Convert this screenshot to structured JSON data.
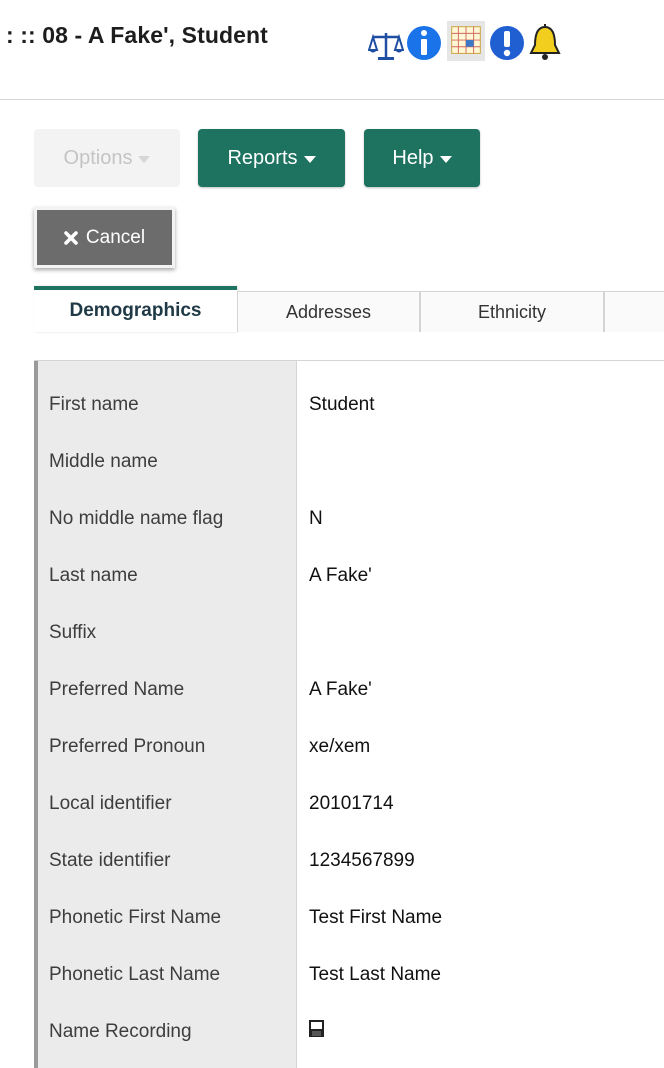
{
  "header": {
    "title": ": :: 08 - A Fake', Student"
  },
  "icons": [
    "scale-icon",
    "info-icon",
    "calendar-icon",
    "alert-icon",
    "bell-icon"
  ],
  "toolbar": {
    "options_label": "Options",
    "reports_label": "Reports",
    "help_label": "Help",
    "cancel_label": "Cancel"
  },
  "tabs": [
    {
      "label": "Demographics",
      "active": true
    },
    {
      "label": "Addresses",
      "active": false
    },
    {
      "label": "Ethnicity",
      "active": false
    },
    {
      "label": "",
      "active": false
    }
  ],
  "fields": [
    {
      "label": "First name",
      "value": "Student"
    },
    {
      "label": "Middle name",
      "value": ""
    },
    {
      "label": "No middle name flag",
      "value": "N"
    },
    {
      "label": "Last name",
      "value": "A Fake'"
    },
    {
      "label": "Suffix",
      "value": ""
    },
    {
      "label": "Preferred Name",
      "value": "A Fake'"
    },
    {
      "label": "Preferred Pronoun",
      "value": "xe/xem"
    },
    {
      "label": "Local identifier",
      "value": "20101714"
    },
    {
      "label": "State identifier",
      "value": "1234567899"
    },
    {
      "label": "Phonetic First Name",
      "value": "Test First Name"
    },
    {
      "label": "Phonetic Last Name",
      "value": "Test Last Name"
    },
    {
      "label": "Name Recording",
      "value": ""
    }
  ],
  "colors": {
    "accent": "#1d7260",
    "cancel_bg": "#6c6c6c",
    "label_bg": "#ebebeb",
    "info_blue": "#1a73e8",
    "bell_yellow": "#f2cf1f"
  }
}
